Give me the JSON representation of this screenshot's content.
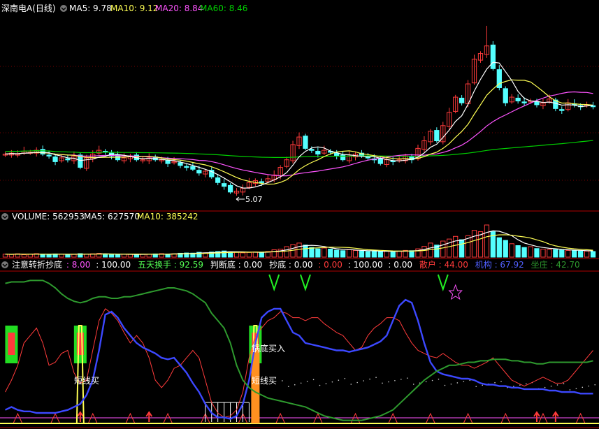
{
  "header1": {
    "title": "深南电A(日线)",
    "ma5": "MA5: 9.78",
    "ma10": "MA10: 9.12",
    "ma20": "MA20: 8.84",
    "ma60": "MA60: 8.46",
    "min_label": "5.07"
  },
  "header2": {
    "title": "VOLUME: 562953",
    "ma5": "MA5: 627570",
    "ma10": "MA10: 385242"
  },
  "header3": {
    "title": "注意转折抄底",
    "v1": ": 8.00",
    "v2": ": 100.00",
    "v3_label": "五天换手",
    "v3": ": 92.59",
    "v4_label": "判断底",
    "v4": ": 0.00",
    "v5_label": "抄底",
    "v5": ": 0.00",
    "v6": ": 0.00",
    "v7": ": 100.00",
    "v8": ": 0.00",
    "v9_label": "散户",
    "v9": ": 44.00",
    "v10_label": "机构",
    "v10": ": 67.92",
    "v11_label": "坐庄",
    "v11": ": 42.70"
  },
  "annotations": {
    "short_buy_1": "短线买",
    "short_buy_2": "短线买",
    "pan_buy": "锅底买入",
    "v_mark": "V"
  },
  "colors": {
    "bg": "#000000",
    "up": "#ff3b3b",
    "down": "#54ffff",
    "ma5": "#ffffff",
    "ma10": "#ffff54",
    "ma20": "#ff54ff",
    "ma60": "#00d000",
    "grid": "#7a0000",
    "panel_border": "#b00000",
    "retail": "#ff3b3b",
    "inst": "#3c48ff",
    "banker": "#2e9a2e"
  },
  "chart_data": [
    {
      "type": "candlestick",
      "name": "深南电A(日线)",
      "count": 95,
      "min_price": 5.07,
      "closes": [
        7.3,
        7.35,
        7.3,
        7.45,
        7.4,
        7.5,
        7.3,
        7.2,
        6.9,
        7.1,
        7.0,
        7.2,
        6.6,
        7.1,
        7.3,
        7.5,
        7.4,
        7.2,
        7.0,
        7.1,
        7.2,
        7.0,
        7.0,
        7.1,
        7.0,
        7.0,
        6.8,
        6.9,
        6.7,
        6.6,
        6.5,
        6.3,
        6.4,
        6.1,
        5.8,
        5.6,
        5.3,
        5.35,
        5.5,
        5.8,
        5.9,
        5.8,
        6.0,
        6.2,
        6.6,
        7.0,
        7.8,
        8.2,
        7.6,
        7.5,
        7.3,
        7.5,
        7.4,
        7.2,
        7.0,
        7.2,
        7.3,
        7.2,
        7.1,
        7.0,
        6.8,
        7.0,
        6.9,
        7.0,
        7.2,
        7.0,
        7.6,
        8.0,
        8.5,
        8.0,
        8.8,
        9.5,
        10.3,
        10.0,
        11.0,
        12.3,
        12.6,
        13.0,
        11.8,
        10.8,
        10.0,
        10.3,
        10.1,
        10.0,
        10.1,
        9.9,
        10.0,
        10.2,
        9.7,
        9.6,
        10.0,
        9.9,
        9.8,
        9.9,
        9.8
      ],
      "ma5": "9.78",
      "ma10": "9.12",
      "ma20": "8.84",
      "ma60": "8.46"
    },
    {
      "type": "bar",
      "name": "VOLUME",
      "volumes": [
        2.2,
        2.0,
        2.5,
        1.8,
        2.3,
        2.6,
        2.0,
        2.1,
        2.4,
        2.2,
        1.9,
        2.0,
        2.6,
        2.3,
        2.5,
        2.8,
        2.2,
        2.0,
        1.9,
        2.1,
        2.3,
        2.0,
        2.2,
        2.1,
        2.4,
        2.6,
        2.3,
        2.5,
        2.9,
        3.1,
        3.0,
        3.6,
        3.2,
        3.8,
        4.2,
        4.6,
        4.0,
        3.6,
        3.2,
        3.5,
        3.9,
        3.7,
        4.2,
        5.5,
        6.0,
        7.8,
        9.5,
        10.5,
        9.0,
        7.2,
        6.2,
        6.8,
        6.0,
        5.2,
        4.8,
        5.5,
        5.0,
        4.6,
        4.2,
        4.4,
        4.0,
        4.6,
        4.2,
        4.4,
        5.0,
        4.8,
        6.2,
        8.0,
        10.5,
        9.0,
        12.0,
        13.5,
        15.5,
        13.0,
        16.0,
        20.0,
        19.0,
        24.0,
        19.0,
        14.5,
        12.5,
        10.0,
        8.6,
        7.2,
        7.8,
        6.4,
        6.0,
        5.6,
        5.6,
        5.2,
        5.0,
        4.8,
        4.6,
        4.5,
        4.2
      ],
      "current": 562953,
      "ma5": 627570,
      "ma10": 385242
    },
    {
      "type": "line",
      "name": "注意转折抄底",
      "ylim": [
        0,
        100
      ],
      "series": [
        {
          "name": "散户",
          "values": [
            22,
            30,
            40,
            55,
            60,
            65,
            55,
            40,
            42,
            48,
            50,
            35,
            28,
            30,
            50,
            70,
            78,
            75,
            70,
            62,
            55,
            60,
            55,
            45,
            30,
            25,
            30,
            38,
            40,
            45,
            50,
            45,
            30,
            15,
            8,
            5,
            6,
            10,
            22,
            45,
            60,
            65,
            70,
            72,
            76,
            75,
            72,
            72,
            70,
            72,
            72,
            68,
            65,
            62,
            60,
            55,
            50,
            52,
            60,
            65,
            68,
            72,
            72,
            70,
            62,
            55,
            50,
            48,
            46,
            45,
            48,
            45,
            42,
            40,
            40,
            38,
            40,
            42,
            45,
            40,
            35,
            30,
            28,
            26,
            28,
            30,
            32,
            30,
            28,
            28,
            30,
            35,
            40,
            45,
            50
          ],
          "value": "44.00"
        },
        {
          "name": "机构",
          "values": [
            10,
            12,
            10,
            9,
            9,
            8,
            8,
            8,
            8,
            9,
            10,
            12,
            14,
            20,
            30,
            50,
            74,
            76,
            72,
            65,
            60,
            55,
            52,
            50,
            48,
            45,
            44,
            45,
            40,
            35,
            28,
            22,
            14,
            8,
            5,
            5,
            4,
            6,
            14,
            30,
            55,
            72,
            76,
            78,
            78,
            70,
            62,
            60,
            55,
            54,
            53,
            52,
            51,
            50,
            50,
            49,
            50,
            51,
            52,
            54,
            56,
            60,
            70,
            80,
            84,
            82,
            70,
            55,
            42,
            36,
            34,
            33,
            32,
            31,
            31,
            30,
            28,
            27,
            27,
            26,
            26,
            25,
            25,
            24,
            24,
            24,
            24,
            23,
            23,
            22,
            22,
            22,
            21,
            21,
            21
          ],
          "value": "67.92"
        },
        {
          "name": "坐庄",
          "values": [
            95,
            96,
            96,
            96,
            97,
            97,
            97,
            95,
            92,
            88,
            85,
            83,
            82,
            83,
            85,
            86,
            86,
            85,
            85,
            86,
            86,
            87,
            88,
            89,
            90,
            91,
            92,
            92,
            91,
            90,
            88,
            85,
            82,
            75,
            70,
            65,
            55,
            40,
            30,
            25,
            22,
            20,
            18,
            17,
            16,
            15,
            14,
            13,
            12,
            10,
            8,
            6,
            5,
            4,
            3,
            3,
            3,
            3,
            4,
            5,
            6,
            8,
            10,
            14,
            18,
            22,
            26,
            30,
            33,
            36,
            38,
            40,
            40,
            41,
            42,
            42,
            43,
            43,
            44,
            44,
            44,
            43,
            43,
            42,
            42,
            41,
            41,
            42,
            42,
            42,
            42,
            42,
            42,
            42,
            43
          ],
          "value": "42.70"
        }
      ]
    }
  ]
}
